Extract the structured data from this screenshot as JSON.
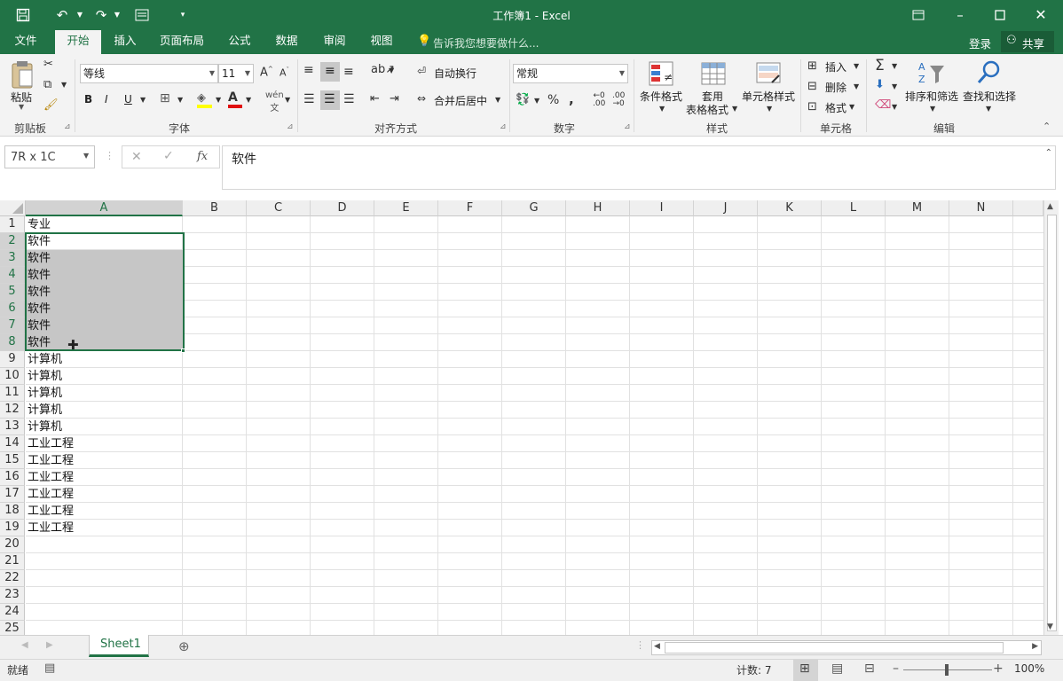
{
  "window": {
    "title": "工作簿1 - Excel"
  },
  "menu": {
    "tabs": [
      "文件",
      "开始",
      "插入",
      "页面布局",
      "公式",
      "数据",
      "审阅",
      "视图"
    ],
    "tell_me": "告诉我您想要做什么...",
    "login": "登录",
    "share": "共享"
  },
  "ribbon": {
    "clipboard": {
      "paste": "粘贴",
      "label": "剪贴板"
    },
    "font": {
      "name": "等线",
      "size": "11",
      "bold": "B",
      "italic": "I",
      "underline": "U",
      "label": "字体"
    },
    "alignment": {
      "wrap": "自动换行",
      "merge": "合并后居中",
      "label": "对齐方式"
    },
    "number": {
      "format": "常规",
      "label": "数字"
    },
    "styles": {
      "conditional": "条件格式",
      "table_line1": "套用",
      "table_line2": "表格格式",
      "cell_styles": "单元格样式",
      "label": "样式"
    },
    "cells": {
      "insert": "插入",
      "delete": "删除",
      "format": "格式",
      "label": "单元格"
    },
    "editing": {
      "sort": "排序和筛选",
      "find": "查找和选择",
      "label": "编辑"
    }
  },
  "formula_bar": {
    "name_box": "7R x 1C",
    "fx": "fx",
    "content": "软件"
  },
  "grid": {
    "columns": [
      "A",
      "B",
      "C",
      "D",
      "E",
      "F",
      "G",
      "H",
      "I",
      "J",
      "K",
      "L",
      "M",
      "N"
    ],
    "rows": [
      "1",
      "2",
      "3",
      "4",
      "5",
      "6",
      "7",
      "8",
      "9",
      "10",
      "11",
      "12",
      "13",
      "14",
      "15",
      "16",
      "17",
      "18",
      "19",
      "20",
      "21",
      "22",
      "23",
      "24",
      "25"
    ],
    "col_a": [
      "专业",
      "软件",
      "软件",
      "软件",
      "软件",
      "软件",
      "软件",
      "软件",
      "计算机",
      "计算机",
      "计算机",
      "计算机",
      "计算机",
      "工业工程",
      "工业工程",
      "工业工程",
      "工业工程",
      "工业工程",
      "工业工程"
    ],
    "selection": "A2:A8"
  },
  "sheet_tabs": {
    "active": "Sheet1"
  },
  "status": {
    "ready": "就绪",
    "count": "计数: 7",
    "zoom": "100%"
  },
  "colors": {
    "accent": "#217346",
    "selection_fill": "#c6c6c6"
  }
}
